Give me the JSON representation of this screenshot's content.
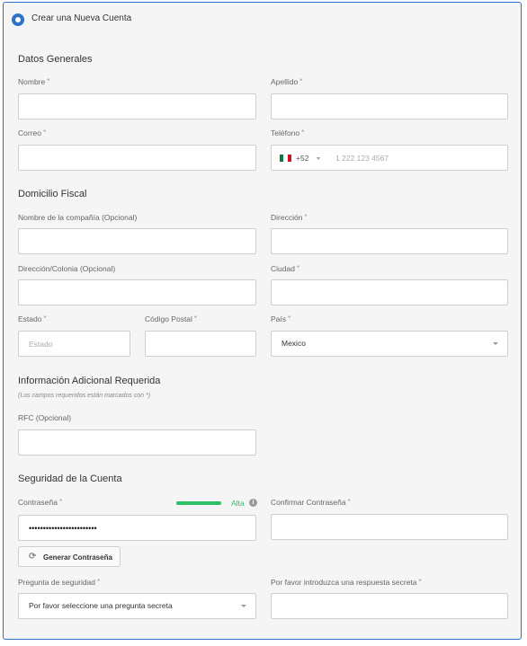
{
  "panel": {
    "title": "Crear una Nueva Cuenta"
  },
  "sections": {
    "general": "Datos Generales",
    "fiscal": "Domicilio Fiscal",
    "additional": "Información Adicional Requerida",
    "additional_hint": "(Los campos requeridos están marcados con *)",
    "security": "Seguridad de la Cuenta"
  },
  "required_mark": "*",
  "fields": {
    "nombre": {
      "label": "Nombre",
      "value": ""
    },
    "apellido": {
      "label": "Apellido",
      "value": ""
    },
    "correo": {
      "label": "Correo",
      "value": ""
    },
    "telefono": {
      "label": "Teléfono",
      "country_code": "+52",
      "flag": "mexico-flag-icon",
      "placeholder": "1 222 123 4567"
    },
    "compania": {
      "label": "Nombre de la compañía (Opcional)",
      "value": ""
    },
    "direccion": {
      "label": "Dirección",
      "value": ""
    },
    "colonia": {
      "label": "Dirección/Colonia (Opcional)",
      "value": ""
    },
    "ciudad": {
      "label": "Ciudad",
      "value": ""
    },
    "estado": {
      "label": "Estado",
      "placeholder": "Estado"
    },
    "codigo_postal": {
      "label": "Código Postal",
      "value": ""
    },
    "pais": {
      "label": "País",
      "selected": "Mexico"
    },
    "rfc": {
      "label": "RFC (Opcional)",
      "value": ""
    },
    "contrasena": {
      "label": "Contraseña",
      "value": "••••••••••••••••••••••••",
      "strength_label": "Alta",
      "strength_fraction": 1.0,
      "strength_color": "#2bbf6a"
    },
    "confirmar": {
      "label": "Confirmar Contraseña",
      "value": ""
    },
    "pregunta": {
      "label": "Pregunta de seguridad",
      "selected": "Por favor seleccione una pregunta secreta"
    },
    "respuesta": {
      "label": "Por favor introduzca una respuesta secreta",
      "value": ""
    }
  },
  "buttons": {
    "generate_password": "Generar Contraseña"
  },
  "colors": {
    "accent": "#2f72c9",
    "strength": "#2bbf6a"
  }
}
